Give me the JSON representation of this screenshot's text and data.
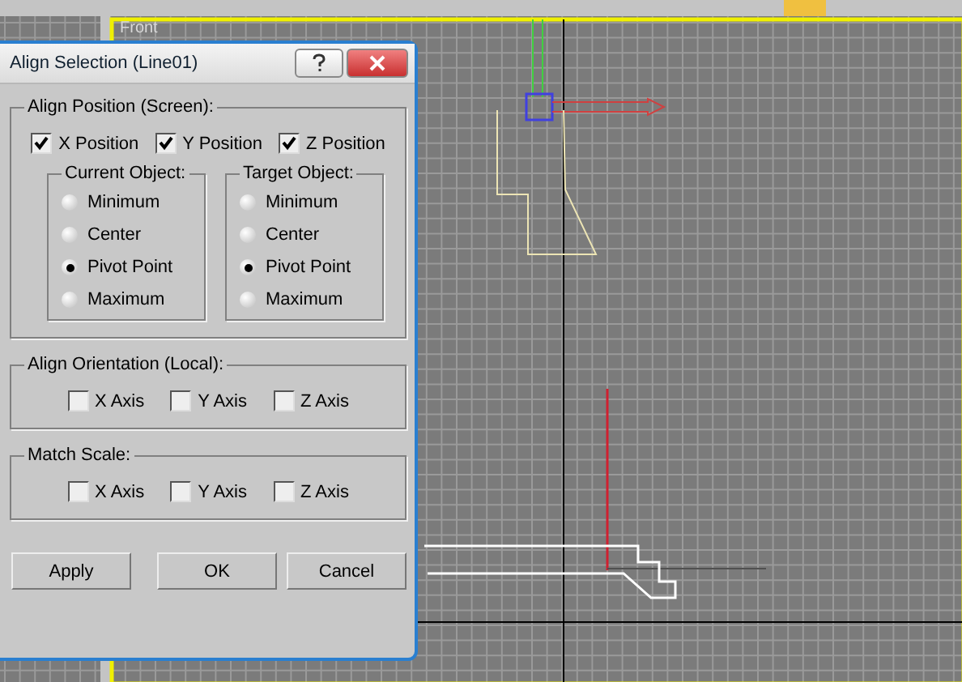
{
  "viewport": {
    "label": "Front"
  },
  "dialog": {
    "title": "Align Selection (Line01)",
    "align_position": {
      "title": "Align Position (Screen):",
      "axes": [
        {
          "label": "X Position",
          "checked": true
        },
        {
          "label": "Y Position",
          "checked": true
        },
        {
          "label": "Z Position",
          "checked": true
        }
      ],
      "current_object": {
        "title": "Current Object:",
        "options": [
          {
            "label": "Minimum",
            "selected": false
          },
          {
            "label": "Center",
            "selected": false
          },
          {
            "label": "Pivot Point",
            "selected": true
          },
          {
            "label": "Maximum",
            "selected": false
          }
        ]
      },
      "target_object": {
        "title": "Target Object:",
        "options": [
          {
            "label": "Minimum",
            "selected": false
          },
          {
            "label": "Center",
            "selected": false
          },
          {
            "label": "Pivot Point",
            "selected": true
          },
          {
            "label": "Maximum",
            "selected": false
          }
        ]
      }
    },
    "align_orientation": {
      "title": "Align Orientation (Local):",
      "axes": [
        {
          "label": "X Axis",
          "checked": false
        },
        {
          "label": "Y Axis",
          "checked": false
        },
        {
          "label": "Z Axis",
          "checked": false
        }
      ]
    },
    "match_scale": {
      "title": "Match Scale:",
      "axes": [
        {
          "label": "X Axis",
          "checked": false
        },
        {
          "label": "Y Axis",
          "checked": false
        },
        {
          "label": "Z Axis",
          "checked": false
        }
      ]
    },
    "buttons": [
      "Apply",
      "OK",
      "Cancel"
    ]
  }
}
